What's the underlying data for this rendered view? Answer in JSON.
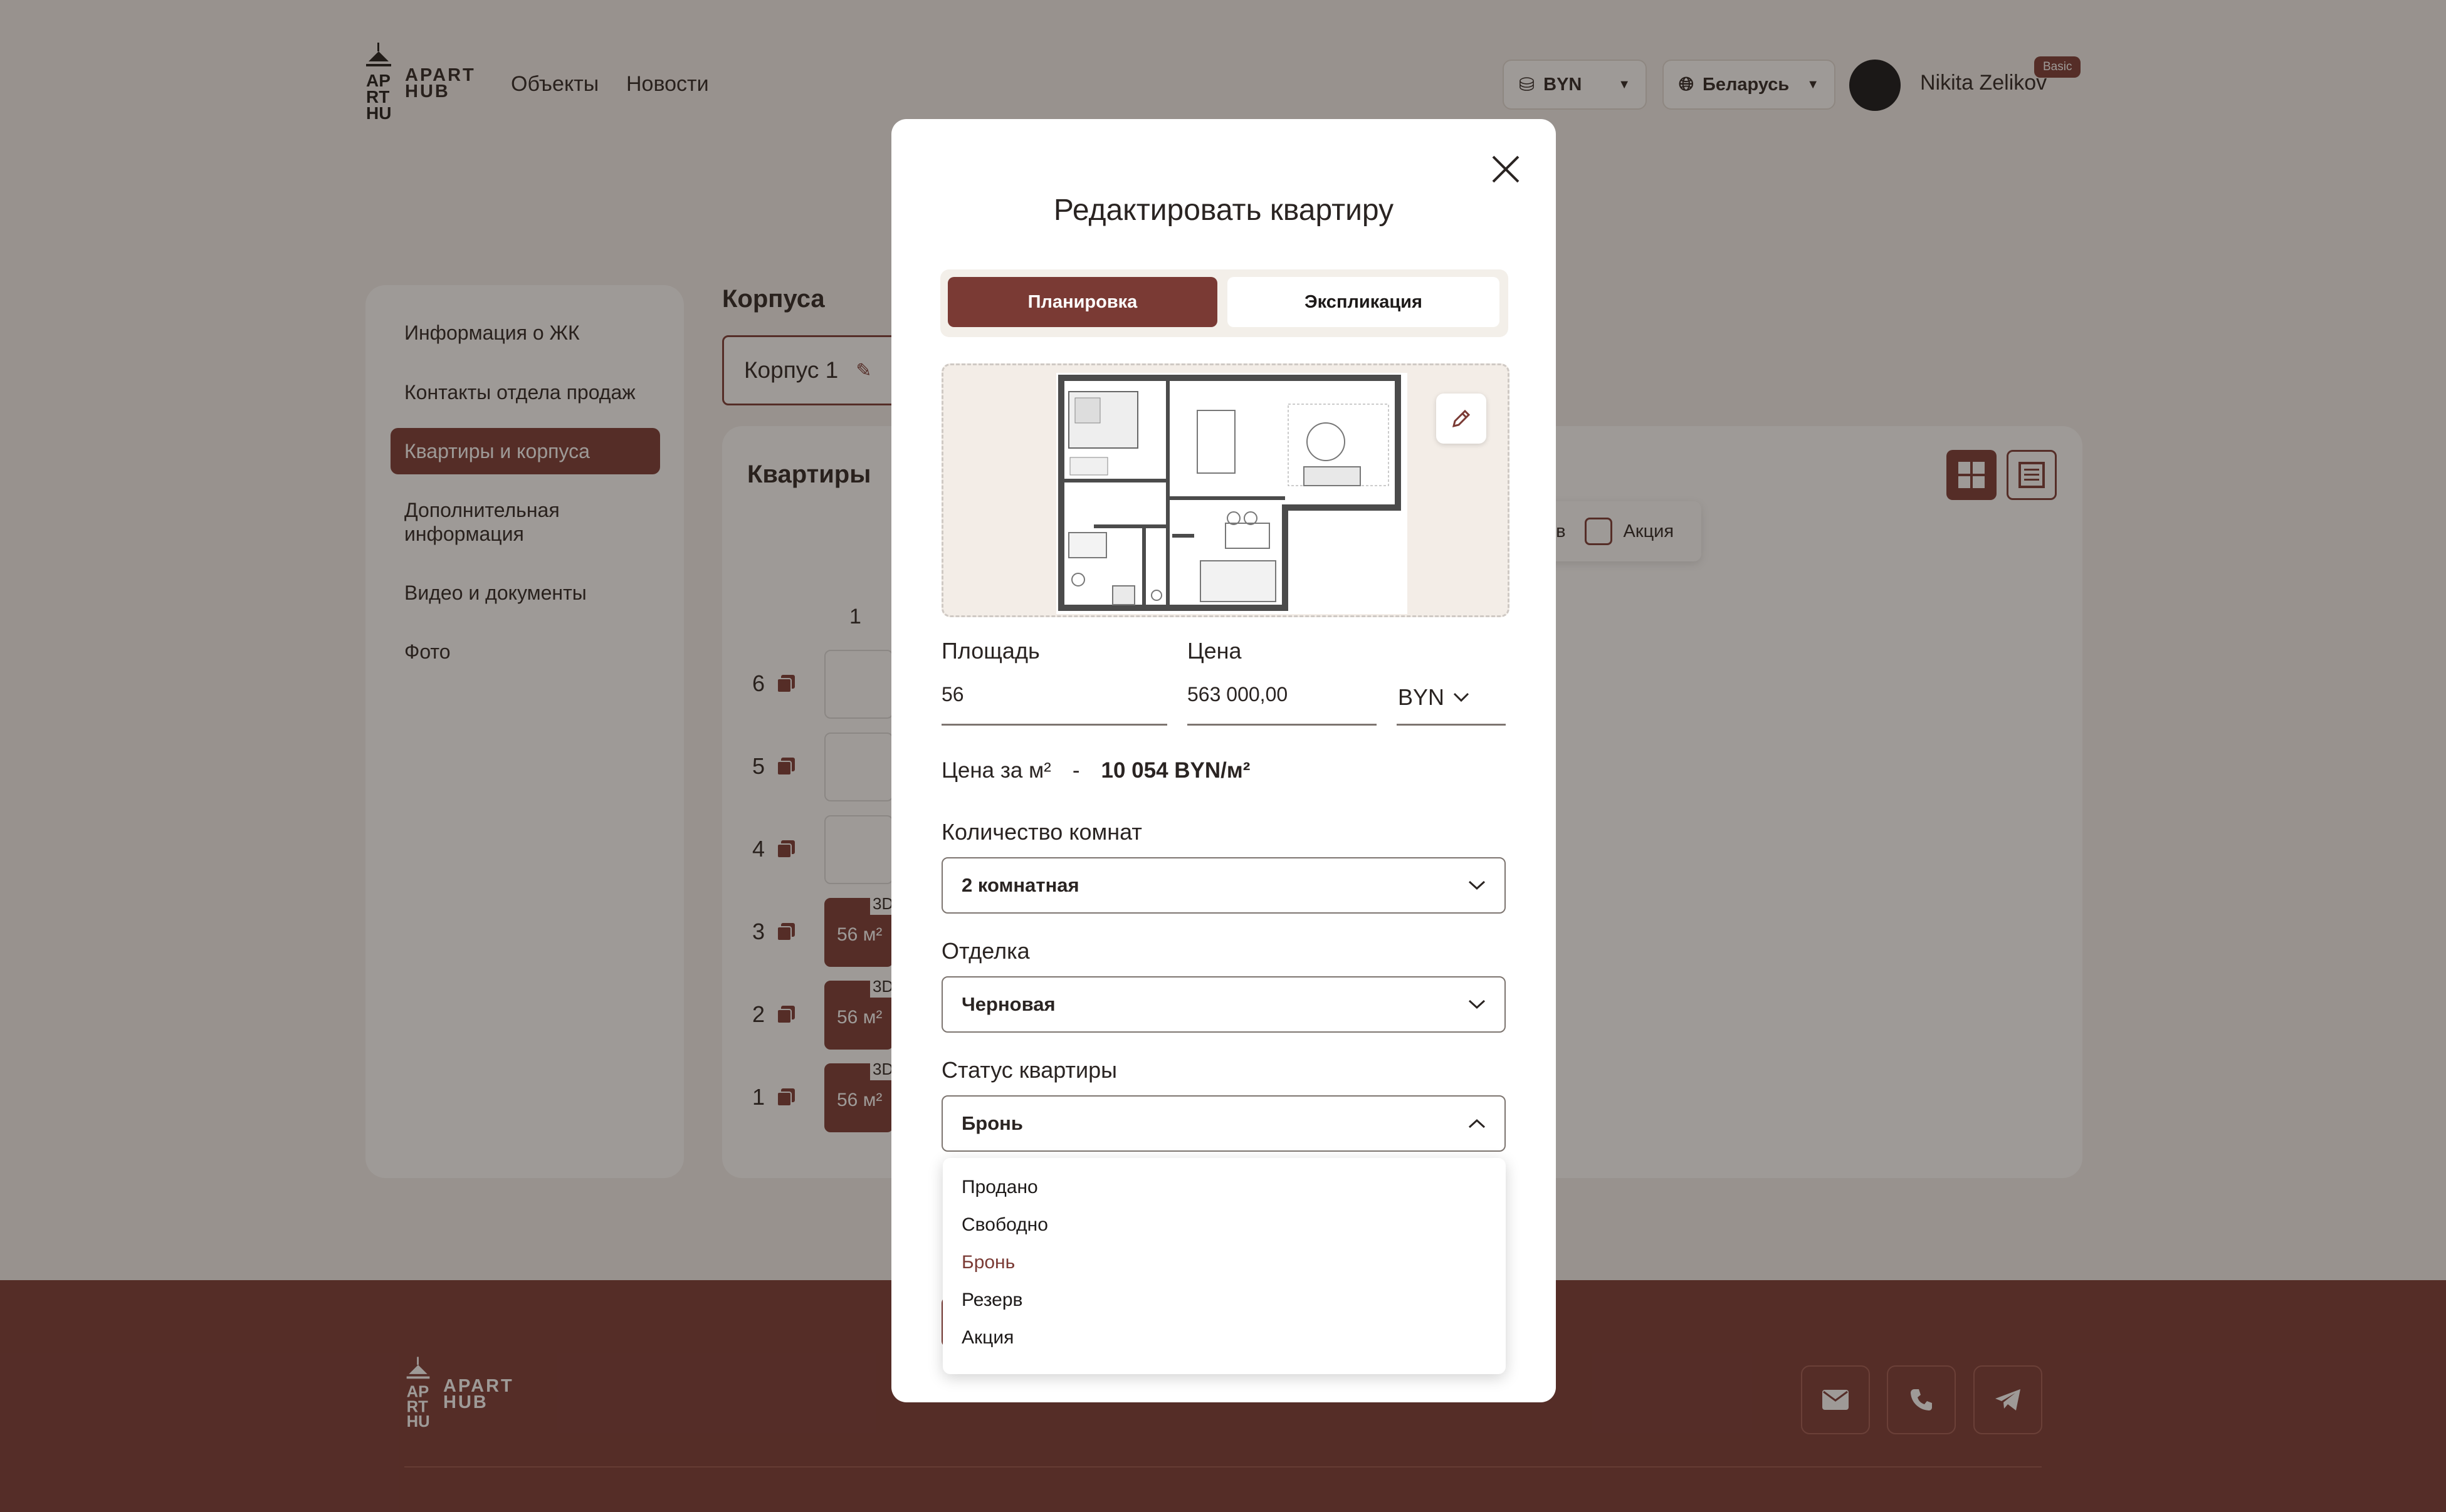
{
  "header": {
    "logo_text_1": "APART",
    "logo_text_2": "HUB",
    "nav": [
      "Объекты",
      "Новости"
    ],
    "currency": "BYN",
    "country": "Беларусь",
    "user_name": "Nikita Zelikov",
    "plan_badge": "Basic"
  },
  "sidebar": {
    "items": [
      {
        "label": "Информация о ЖК"
      },
      {
        "label": "Контакты отдела продаж"
      },
      {
        "label": "Квартиры и корпуса",
        "active": true
      },
      {
        "label": "Дополнительная информация"
      },
      {
        "label": "Видео и документы"
      },
      {
        "label": "Фото"
      }
    ]
  },
  "main": {
    "corpus_title": "Корпуса",
    "corpus_tab": "Корпус 1",
    "apartments_title": "Квартиры",
    "filter_partial": "рв",
    "filter_label": "Акция",
    "column_header": "1",
    "floors": [
      {
        "num": "6",
        "area": ""
      },
      {
        "num": "5",
        "area": ""
      },
      {
        "num": "4",
        "area": ""
      },
      {
        "num": "3",
        "area": "56 м²",
        "tag": "3D"
      },
      {
        "num": "2",
        "area": "56 м²",
        "tag": "3D"
      },
      {
        "num": "1",
        "area": "56 м²",
        "tag": "3D"
      }
    ]
  },
  "modal": {
    "title": "Редактировать квартиру",
    "tabs": [
      {
        "label": "Планировка",
        "active": true
      },
      {
        "label": "Экспликация",
        "active": false
      }
    ],
    "area_label": "Площадь",
    "area_value": "56",
    "price_label": "Цена",
    "price_value": "563 000,00",
    "price_currency": "BYN",
    "price_per_m2_label": "Цена за м²",
    "price_per_m2_dash": "-",
    "price_per_m2_value": "10 054 BYN/м²",
    "rooms_label": "Количество комнат",
    "rooms_value": "2 комнатная",
    "finish_label": "Отделка",
    "finish_value": "Черновая",
    "status_label": "Статус квартиры",
    "status_value": "Бронь",
    "status_options": [
      "Продано",
      "Свободно",
      "Бронь",
      "Резерв",
      "Акция"
    ]
  },
  "footer": {
    "logo_text_1": "APART",
    "logo_text_2": "HUB",
    "icons": [
      "mail-icon",
      "phone-icon",
      "telegram-icon"
    ]
  },
  "colors": {
    "accent": "#7a3a34",
    "background": "#f4f1ee",
    "overlay": "rgba(40,30,25,0.45)"
  }
}
